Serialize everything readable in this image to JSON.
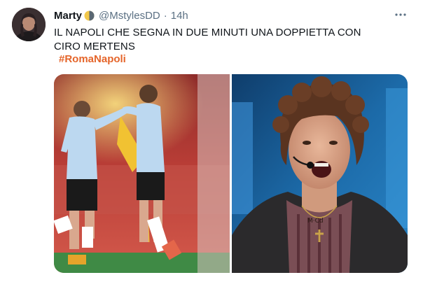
{
  "tweet": {
    "display_name": "Marty",
    "handle": "@MstylesDD",
    "separator": "·",
    "time": "14h",
    "text": "IL NAPOLI CHE SEGNA IN DUE MINUTI UNA DOPPIETTA CON CIRO MERTENS",
    "hashtag": "#RomaNapoli",
    "name_emoji": "moon-icon",
    "more_icon": "more-horizontal-icon"
  },
  "media": {
    "image_count": 2,
    "image_1": "football-celebration-photo",
    "image_2": "singer-with-headset-mic-photo"
  },
  "colors": {
    "text": "#0f1419",
    "secondary": "#5b7083",
    "hashtag": "#e5652a"
  }
}
